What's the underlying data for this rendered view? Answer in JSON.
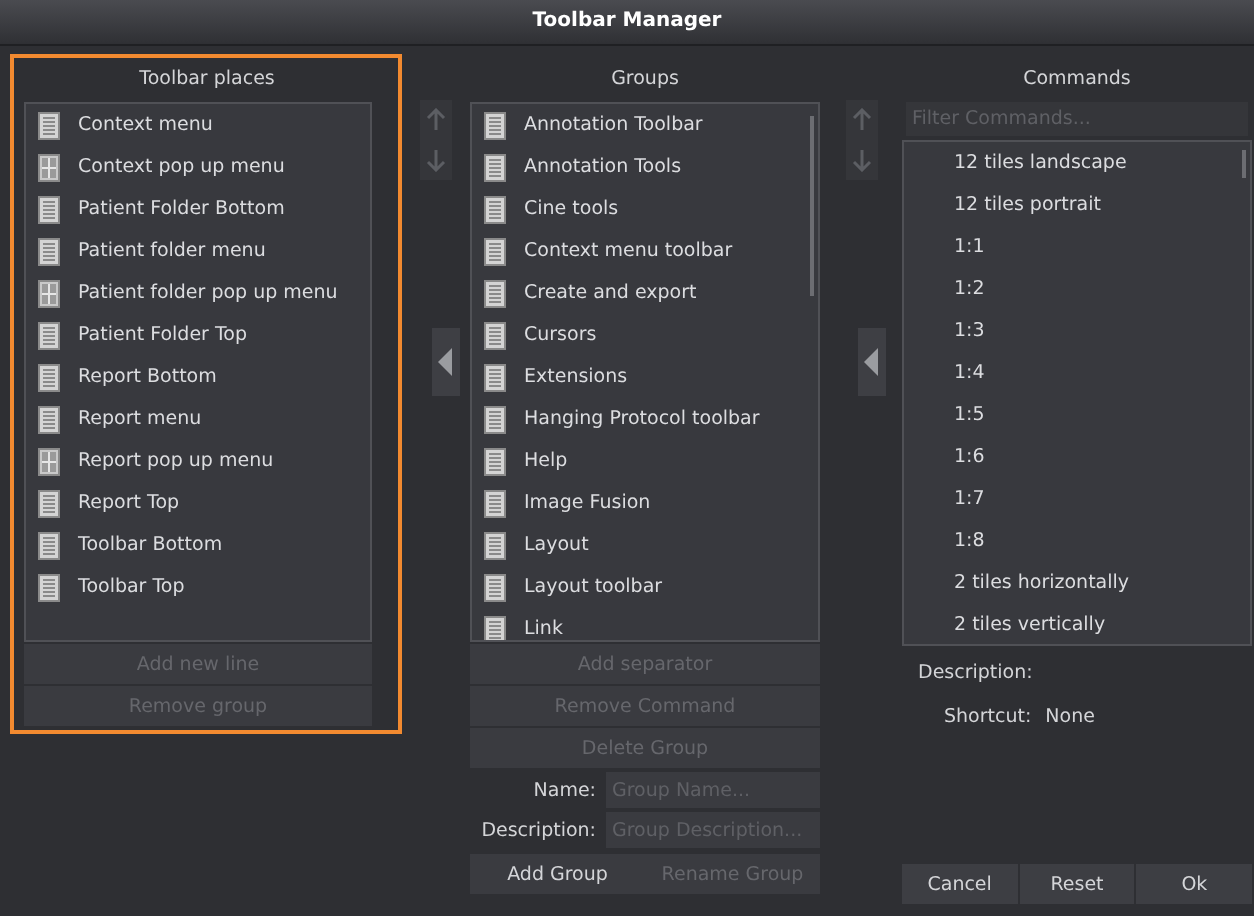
{
  "window": {
    "title": "Toolbar Manager"
  },
  "places": {
    "title": "Toolbar places",
    "items": [
      {
        "label": "Context menu",
        "kind": "list",
        "selected": false
      },
      {
        "label": "Context pop up menu",
        "kind": "grid",
        "selected": false
      },
      {
        "label": "Patient Folder Bottom",
        "kind": "list",
        "selected": false
      },
      {
        "label": "Patient folder menu",
        "kind": "list",
        "selected": false
      },
      {
        "label": "Patient folder pop up menu",
        "kind": "grid",
        "selected": false
      },
      {
        "label": "Patient Folder Top",
        "kind": "list",
        "selected": false
      },
      {
        "label": "Report Bottom",
        "kind": "list",
        "selected": false
      },
      {
        "label": "Report menu",
        "kind": "list",
        "selected": false
      },
      {
        "label": "Report pop up menu",
        "kind": "grid",
        "selected": false
      },
      {
        "label": "Report Top",
        "kind": "list",
        "selected": false
      },
      {
        "label": "Toolbar Bottom",
        "kind": "list",
        "selected": false
      },
      {
        "label": "Toolbar Top",
        "kind": "list",
        "selected": false
      }
    ],
    "buttons": [
      {
        "label": "Add new line",
        "disabled": true
      },
      {
        "label": "Remove group",
        "disabled": true
      }
    ]
  },
  "groups": {
    "title": "Groups",
    "items": [
      {
        "label": "Annotation Toolbar",
        "kind": "list",
        "selected": false
      },
      {
        "label": "Annotation Tools",
        "kind": "list",
        "selected": false
      },
      {
        "label": "Cine tools",
        "kind": "list",
        "selected": false
      },
      {
        "label": "Context menu toolbar",
        "kind": "list",
        "selected": false
      },
      {
        "label": "Create and export",
        "kind": "list",
        "selected": false
      },
      {
        "label": "Cursors",
        "kind": "list",
        "selected": false
      },
      {
        "label": "Extensions",
        "kind": "list",
        "selected": false
      },
      {
        "label": "Hanging Protocol toolbar",
        "kind": "list",
        "selected": false
      },
      {
        "label": "Help",
        "kind": "list",
        "selected": false
      },
      {
        "label": "Image Fusion",
        "kind": "list",
        "selected": false
      },
      {
        "label": "Layout",
        "kind": "list",
        "selected": false
      },
      {
        "label": "Layout toolbar",
        "kind": "list",
        "selected": false
      },
      {
        "label": "Link",
        "kind": "list",
        "selected": false
      }
    ],
    "buttons": [
      {
        "label": "Add separator",
        "disabled": true
      },
      {
        "label": "Remove Command",
        "disabled": true
      },
      {
        "label": "Delete Group",
        "disabled": true
      }
    ],
    "fields": [
      {
        "label": "Name:",
        "placeholder": "Group Name..."
      },
      {
        "label": "Description:",
        "placeholder": "Group Description..."
      }
    ],
    "actions": [
      {
        "label": "Add Group",
        "disabled": false
      },
      {
        "label": "Rename Group",
        "disabled": true
      }
    ]
  },
  "commands": {
    "title": "Commands",
    "filter": {
      "placeholder": "Filter Commands..."
    },
    "items": [
      {
        "label": "12 tiles landscape",
        "selected": false
      },
      {
        "label": "12 tiles portrait",
        "selected": false
      },
      {
        "label": "1:1",
        "selected": false
      },
      {
        "label": "1:2",
        "selected": false
      },
      {
        "label": "1:3",
        "selected": false
      },
      {
        "label": "1:4",
        "selected": false
      },
      {
        "label": "1:5",
        "selected": false
      },
      {
        "label": "1:6",
        "selected": false
      },
      {
        "label": "1:7",
        "selected": false
      },
      {
        "label": "1:8",
        "selected": false
      },
      {
        "label": "2 tiles horizontally",
        "selected": false
      },
      {
        "label": "2 tiles vertically",
        "selected": false
      }
    ],
    "description_label": "Description:",
    "shortcut_label": "Shortcut:",
    "shortcut_value": "None"
  },
  "footer": [
    {
      "label": "Cancel",
      "disabled": false
    },
    {
      "label": "Reset",
      "disabled": false
    },
    {
      "label": "Ok",
      "disabled": false
    }
  ]
}
